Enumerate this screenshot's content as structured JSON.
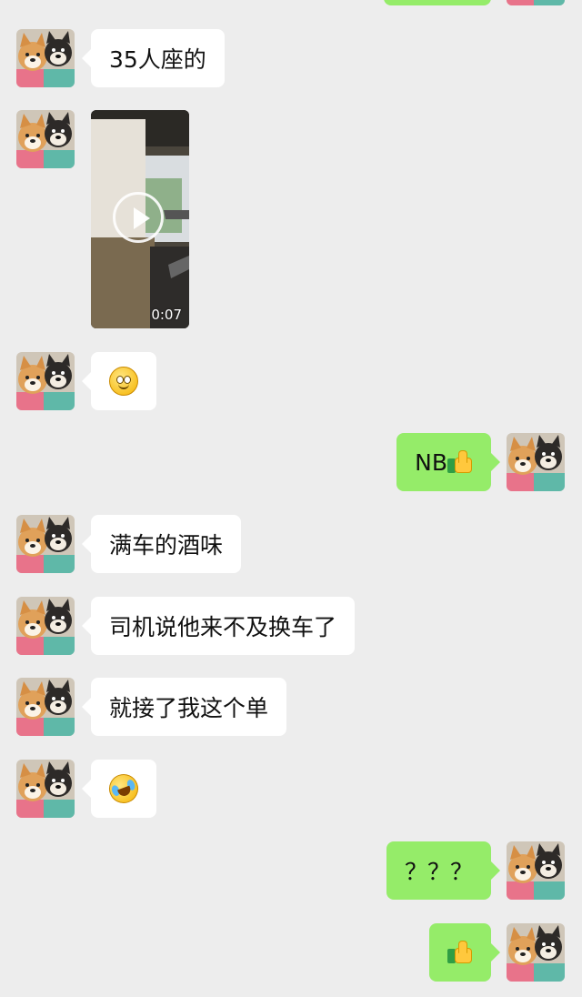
{
  "chat": {
    "messages": [
      {
        "id": "m1",
        "direction": "incoming",
        "type": "text",
        "text": "35人座的"
      },
      {
        "id": "m2",
        "direction": "incoming",
        "type": "video",
        "duration": "0:07"
      },
      {
        "id": "m3",
        "direction": "incoming",
        "type": "emoji",
        "emoji": "slightly-smiling-face"
      },
      {
        "id": "m4",
        "direction": "outgoing",
        "type": "text",
        "text": "NB",
        "emoji": "thumbs-up"
      },
      {
        "id": "m5",
        "direction": "incoming",
        "type": "text",
        "text": "满车的酒味"
      },
      {
        "id": "m6",
        "direction": "incoming",
        "type": "text",
        "text": "司机说他来不及换车了"
      },
      {
        "id": "m7",
        "direction": "incoming",
        "type": "text",
        "text": "就接了我这个单"
      },
      {
        "id": "m8",
        "direction": "incoming",
        "type": "emoji",
        "emoji": "rolling-on-floor-laughing"
      },
      {
        "id": "m9",
        "direction": "outgoing",
        "type": "text",
        "text": "？？？"
      },
      {
        "id": "m10",
        "direction": "outgoing",
        "type": "emoji",
        "emoji": "thumbs-up"
      }
    ]
  },
  "colors": {
    "background": "#ededed",
    "incoming_bubble": "#ffffff",
    "outgoing_bubble": "#95ec69"
  },
  "icons": {
    "avatar": "shiba-dogs-avatar",
    "play": "play-icon"
  }
}
